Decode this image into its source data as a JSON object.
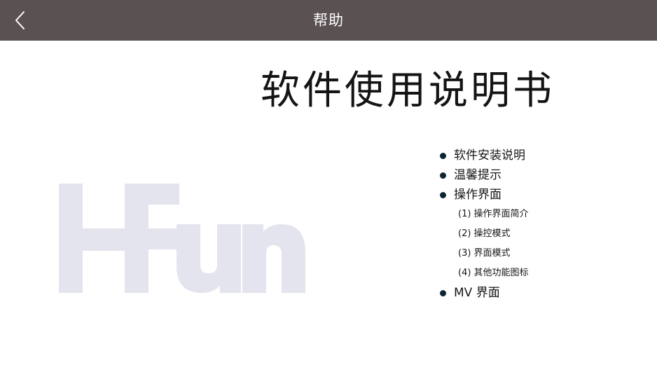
{
  "header": {
    "title": "帮助",
    "back_icon": "chevron-left-icon"
  },
  "document": {
    "title": "软件使用说明书",
    "logo_text": "HFun",
    "logo_color": "#e4e4ee"
  },
  "toc": {
    "items": [
      {
        "label": "软件安装说明"
      },
      {
        "label": "温馨提示"
      },
      {
        "label": "操作界面"
      },
      {
        "label": "MV 界面"
      }
    ],
    "subitems": [
      {
        "label": "(1) 操作界面简介"
      },
      {
        "label": "(2) 操控模式"
      },
      {
        "label": "(3) 界面模式"
      },
      {
        "label": "(4) 其他功能图标"
      }
    ]
  },
  "colors": {
    "header_bg": "#5a5152",
    "header_text": "#ffffff",
    "bullet": "#0d2530",
    "text": "#161616"
  }
}
